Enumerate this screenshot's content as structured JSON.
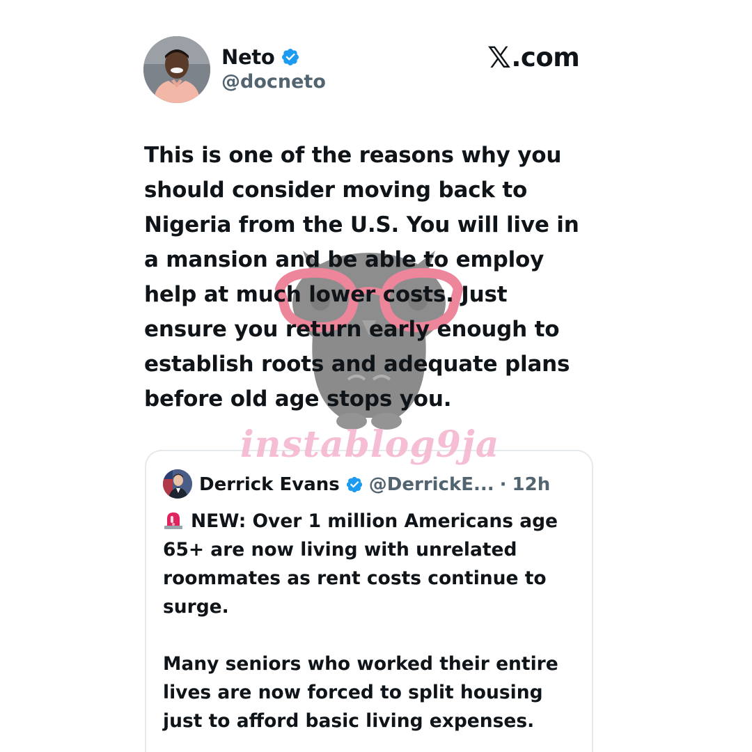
{
  "site": {
    "logo_text": ".com",
    "logo_mark": "𝕏"
  },
  "author": {
    "name": "Neto",
    "handle": "@docneto",
    "verified": true,
    "avatar_icon": "avatar-photo"
  },
  "tweet": {
    "lines": [
      "This is one of the reasons why you",
      "should consider moving back to",
      "Nigeria from the U.S. You will live in",
      "a mansion and be able to employ",
      "help at much lower costs. Just",
      "ensure you return early enough to",
      "establish roots and adequate plans",
      "before old age stops you."
    ]
  },
  "watermark": {
    "text": "instablog9ja"
  },
  "quoted": {
    "name": "Derrick Evans",
    "handle": "@DerrickE...",
    "separator": "·",
    "time": "12h",
    "verified": true,
    "paragraph1": [
      "NEW: Over 1 million Americans age",
      "65+ are now living with unrelated",
      "roommates as rent costs continue to",
      "surge."
    ],
    "paragraph2": [
      "Many seniors who worked their entire",
      "lives are now forced to split housing",
      "just to afford basic living expenses."
    ],
    "leading_icon": "siren-icon"
  },
  "colors": {
    "text_primary": "#0f1419",
    "text_secondary": "#536471",
    "verified_blue": "#1d9bf0",
    "watermark_pink": "#f4b6cf",
    "border": "#e5e9ec"
  }
}
